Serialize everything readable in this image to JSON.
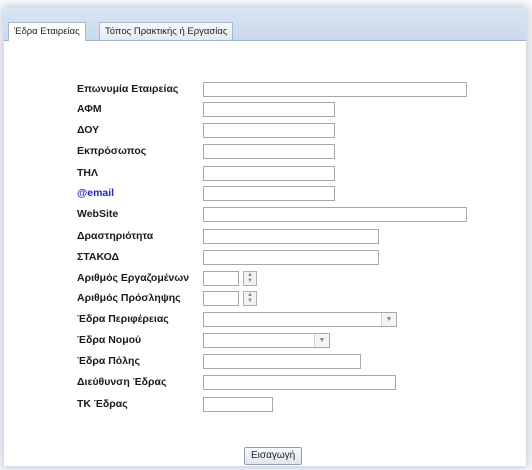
{
  "tabs": [
    {
      "label": "Έδρα Εταιρείας"
    },
    {
      "label": "Τόπος Πρακτικής ή Εργασίας"
    }
  ],
  "form": {
    "company_name_label": "Επωνυμία Εταιρείας",
    "afm_label": "ΑΦΜ",
    "doy_label": "ΔΟΥ",
    "representative_label": "Εκπρόσωπος",
    "phone_label": "ΤΗΛ",
    "email_label": "@email",
    "website_label": "WebSite",
    "activity_label": "Δραστηριότητα",
    "stakod_label": "ΣΤΑΚΟΔ",
    "employees_label": "Αριθμός Εργαζομένων",
    "hires_label": "Αριθμός Πρόσληψης",
    "region_label": "Έδρα Περιφέρειας",
    "prefecture_label": "Έδρα Νομού",
    "city_label": "Έδρα Πόλης",
    "address_label": "Διεύθυνση Έδρας",
    "postal_code_label": "ΤΚ Έδρας"
  },
  "submit_label": "Εισαγωγή"
}
